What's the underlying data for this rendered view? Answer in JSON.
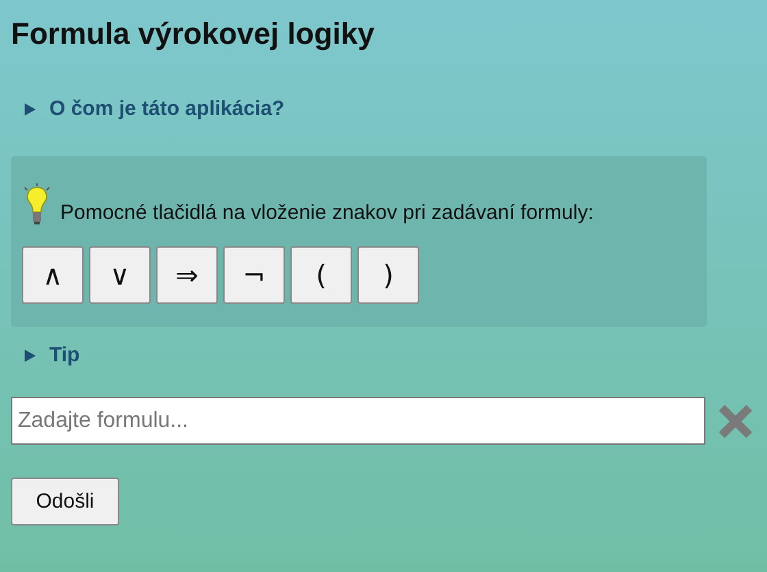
{
  "title": "Formula výrokovej logiky",
  "about": {
    "label": "O čom je táto aplikácia?",
    "expanded": false
  },
  "helper": {
    "text": "Pomocné tlačidlá na vloženie znakov pri zadávaní formuly:",
    "buttons": [
      "∧",
      "∨",
      "⇒",
      "¬",
      "(",
      ")"
    ]
  },
  "tip": {
    "label": "Tip",
    "expanded": false
  },
  "formula": {
    "placeholder": "Zadajte formulu..."
  },
  "submit": "Odošli"
}
